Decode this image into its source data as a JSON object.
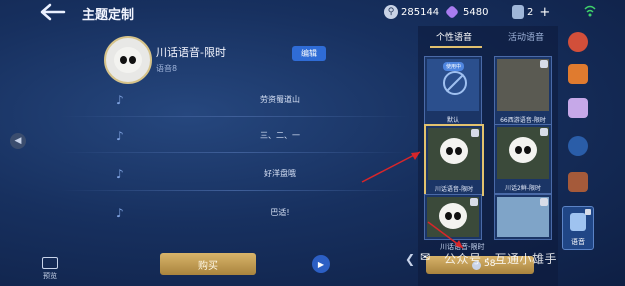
{
  "header": {
    "title": "主题定制",
    "coins": "285144",
    "gems": "5480",
    "tickets": "2",
    "plus": "+"
  },
  "current_voice": {
    "name": "川话语音-限时",
    "sub": "语音8",
    "edit_label": "编辑"
  },
  "lines": [
    {
      "text": "劳资蜀道山"
    },
    {
      "text": "三、二、一"
    },
    {
      "text": "好洋盘哦"
    },
    {
      "text": "巴适!"
    }
  ],
  "left_actions": {
    "preview_label": "预览",
    "buy_label": "购买"
  },
  "tabs": [
    {
      "label": "个性语音",
      "active": true
    },
    {
      "label": "活动语音",
      "active": false
    }
  ],
  "cards": [
    {
      "caption": "默认",
      "badge": "使用中"
    },
    {
      "caption": "66西游语音-限时"
    },
    {
      "caption": "川话语音-限时"
    },
    {
      "caption": "川话2鲜-限时"
    },
    {
      "caption": ""
    },
    {
      "caption": ""
    }
  ],
  "bottom": {
    "selected_label": "川话语音-限时",
    "price": "58"
  },
  "categories": {
    "voice_label": "语音"
  },
  "watermark": "公众号 · 互通小雄手",
  "colors": {
    "accent_gold": "#e2c26e",
    "button_blue": "#2f6cd6",
    "arrow_red": "#d8262a"
  }
}
